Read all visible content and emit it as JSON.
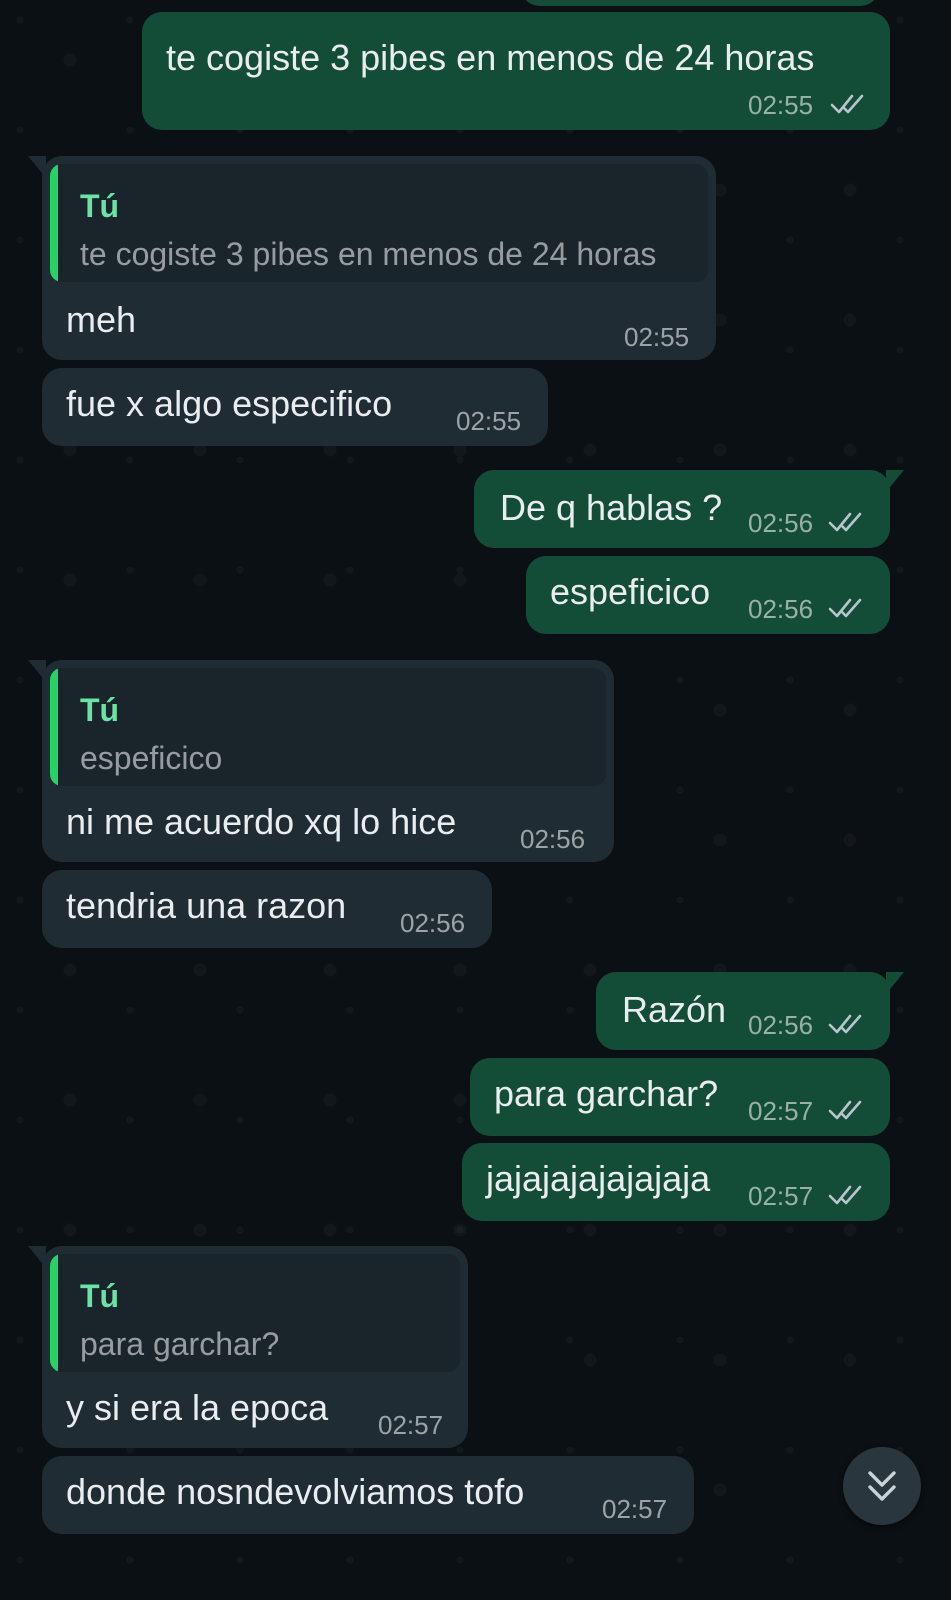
{
  "messages": [
    {
      "dir": "out",
      "text": "te cogiste 3 pibes en menos de 24 horas",
      "time": "02:55"
    },
    {
      "dir": "in",
      "quote_author": "Tú",
      "quote_text": "te cogiste 3 pibes en menos de 24 horas",
      "text": "meh",
      "time": "02:55"
    },
    {
      "dir": "in",
      "text": "fue x algo especifico",
      "time": "02:55"
    },
    {
      "dir": "out",
      "text": "De q hablas ?",
      "time": "02:56"
    },
    {
      "dir": "out",
      "text": "espeficico",
      "time": "02:56"
    },
    {
      "dir": "in",
      "quote_author": "Tú",
      "quote_text": "espeficico",
      "text": "ni me acuerdo xq lo hice",
      "time": "02:56"
    },
    {
      "dir": "in",
      "text": "tendria una razon",
      "time": "02:56"
    },
    {
      "dir": "out",
      "text": "Razón",
      "time": "02:56"
    },
    {
      "dir": "out",
      "text": "para garchar?",
      "time": "02:57"
    },
    {
      "dir": "out",
      "text": "jajajajajajajaja",
      "time": "02:57"
    },
    {
      "dir": "in",
      "quote_author": "Tú",
      "quote_text": "para garchar?",
      "text": "y si era la epoca",
      "time": "02:57"
    },
    {
      "dir": "in",
      "text": "donde nosndevolviamos tofo",
      "time": "02:57"
    }
  ],
  "status": {
    "read_ticks_icon": "double-check-read-icon"
  },
  "colors": {
    "background": "#0b1014",
    "incoming_bubble": "#1f2c33",
    "outgoing_bubble": "#144d37",
    "quote_accent": "#25d366",
    "quote_author": "#6be3a5"
  },
  "scroll_button": {
    "icon": "double-chevron-down-icon"
  }
}
